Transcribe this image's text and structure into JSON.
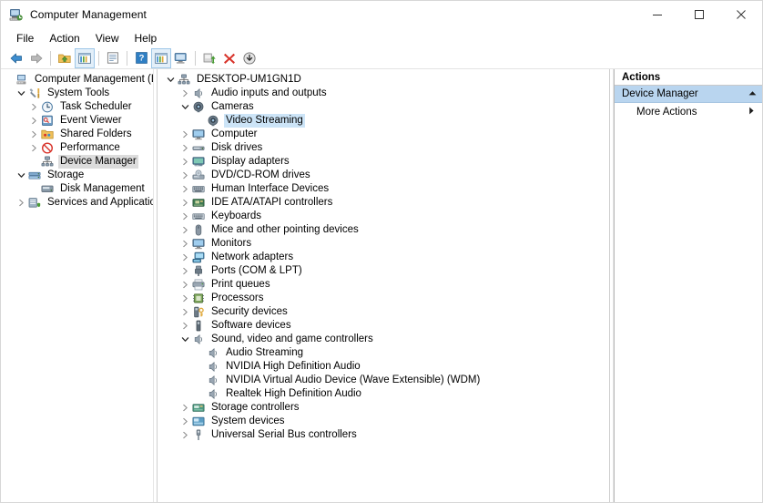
{
  "window": {
    "title": "Computer Management",
    "icon": "computer-management-icon",
    "controls": {
      "minimize": "minimize-icon",
      "maximize": "maximize-icon",
      "close": "close-icon"
    }
  },
  "menubar": {
    "items": [
      {
        "label": "File"
      },
      {
        "label": "Action"
      },
      {
        "label": "View"
      },
      {
        "label": "Help"
      }
    ]
  },
  "toolbar": {
    "buttons": [
      {
        "name": "back-icon"
      },
      {
        "name": "forward-icon"
      },
      {
        "name": "up-folder-icon"
      },
      {
        "name": "show-hide-console-tree-icon"
      },
      {
        "name": "properties-icon"
      },
      {
        "name": "help-icon"
      },
      {
        "name": "show-hide-action-pane-icon"
      },
      {
        "name": "scan-hardware-changes-icon"
      },
      {
        "name": "update-driver-icon"
      },
      {
        "name": "uninstall-device-icon"
      },
      {
        "name": "disable-device-icon"
      }
    ]
  },
  "console_tree": {
    "items": [
      {
        "label": "Computer Management (Local",
        "depth": 0,
        "twisty": "none",
        "icon": "computer-management-icon",
        "selected": "none"
      },
      {
        "label": "System Tools",
        "depth": 1,
        "twisty": "expanded",
        "icon": "system-tools-icon",
        "selected": "none"
      },
      {
        "label": "Task Scheduler",
        "depth": 2,
        "twisty": "collapsed",
        "icon": "clock-icon",
        "selected": "none"
      },
      {
        "label": "Event Viewer",
        "depth": 2,
        "twisty": "collapsed",
        "icon": "event-viewer-icon",
        "selected": "none"
      },
      {
        "label": "Shared Folders",
        "depth": 2,
        "twisty": "collapsed",
        "icon": "shared-folders-icon",
        "selected": "none"
      },
      {
        "label": "Performance",
        "depth": 2,
        "twisty": "collapsed",
        "icon": "performance-icon",
        "selected": "none"
      },
      {
        "label": "Device Manager",
        "depth": 2,
        "twisty": "none",
        "icon": "device-manager-icon",
        "selected": "inactive"
      },
      {
        "label": "Storage",
        "depth": 1,
        "twisty": "expanded",
        "icon": "storage-icon",
        "selected": "none"
      },
      {
        "label": "Disk Management",
        "depth": 2,
        "twisty": "none",
        "icon": "disk-management-icon",
        "selected": "none"
      },
      {
        "label": "Services and Applications",
        "depth": 1,
        "twisty": "collapsed",
        "icon": "services-icon",
        "selected": "none"
      }
    ]
  },
  "device_tree": {
    "items": [
      {
        "label": "DESKTOP-UM1GN1D",
        "depth": 0,
        "twisty": "expanded",
        "icon": "computer-node-icon",
        "selected": "none"
      },
      {
        "label": "Audio inputs and outputs",
        "depth": 1,
        "twisty": "collapsed",
        "icon": "speaker-icon",
        "selected": "none"
      },
      {
        "label": "Cameras",
        "depth": 1,
        "twisty": "expanded",
        "icon": "camera-icon",
        "selected": "none"
      },
      {
        "label": "Video Streaming",
        "depth": 2,
        "twisty": "none",
        "icon": "camera-icon",
        "selected": "active"
      },
      {
        "label": "Computer",
        "depth": 1,
        "twisty": "collapsed",
        "icon": "monitor-icon",
        "selected": "none"
      },
      {
        "label": "Disk drives",
        "depth": 1,
        "twisty": "collapsed",
        "icon": "disk-drive-icon",
        "selected": "none"
      },
      {
        "label": "Display adapters",
        "depth": 1,
        "twisty": "collapsed",
        "icon": "display-adapter-icon",
        "selected": "none"
      },
      {
        "label": "DVD/CD-ROM drives",
        "depth": 1,
        "twisty": "collapsed",
        "icon": "dvd-drive-icon",
        "selected": "none"
      },
      {
        "label": "Human Interface Devices",
        "depth": 1,
        "twisty": "collapsed",
        "icon": "hid-icon",
        "selected": "none"
      },
      {
        "label": "IDE ATA/ATAPI controllers",
        "depth": 1,
        "twisty": "collapsed",
        "icon": "ide-controller-icon",
        "selected": "none"
      },
      {
        "label": "Keyboards",
        "depth": 1,
        "twisty": "collapsed",
        "icon": "keyboard-icon",
        "selected": "none"
      },
      {
        "label": "Mice and other pointing devices",
        "depth": 1,
        "twisty": "collapsed",
        "icon": "mouse-icon",
        "selected": "none"
      },
      {
        "label": "Monitors",
        "depth": 1,
        "twisty": "collapsed",
        "icon": "monitor-icon",
        "selected": "none"
      },
      {
        "label": "Network adapters",
        "depth": 1,
        "twisty": "collapsed",
        "icon": "network-adapter-icon",
        "selected": "none"
      },
      {
        "label": "Ports (COM & LPT)",
        "depth": 1,
        "twisty": "collapsed",
        "icon": "port-icon",
        "selected": "none"
      },
      {
        "label": "Print queues",
        "depth": 1,
        "twisty": "collapsed",
        "icon": "printer-icon",
        "selected": "none"
      },
      {
        "label": "Processors",
        "depth": 1,
        "twisty": "collapsed",
        "icon": "processor-icon",
        "selected": "none"
      },
      {
        "label": "Security devices",
        "depth": 1,
        "twisty": "collapsed",
        "icon": "security-device-icon",
        "selected": "none"
      },
      {
        "label": "Software devices",
        "depth": 1,
        "twisty": "collapsed",
        "icon": "software-device-icon",
        "selected": "none"
      },
      {
        "label": "Sound, video and game controllers",
        "depth": 1,
        "twisty": "expanded",
        "icon": "speaker-icon",
        "selected": "none"
      },
      {
        "label": "Audio Streaming",
        "depth": 2,
        "twisty": "none",
        "icon": "speaker-icon",
        "selected": "none"
      },
      {
        "label": "NVIDIA High Definition Audio",
        "depth": 2,
        "twisty": "none",
        "icon": "speaker-icon",
        "selected": "none"
      },
      {
        "label": "NVIDIA Virtual Audio Device (Wave Extensible) (WDM)",
        "depth": 2,
        "twisty": "none",
        "icon": "speaker-icon",
        "selected": "none"
      },
      {
        "label": "Realtek High Definition Audio",
        "depth": 2,
        "twisty": "none",
        "icon": "speaker-icon",
        "selected": "none"
      },
      {
        "label": "Storage controllers",
        "depth": 1,
        "twisty": "collapsed",
        "icon": "storage-controller-icon",
        "selected": "none"
      },
      {
        "label": "System devices",
        "depth": 1,
        "twisty": "collapsed",
        "icon": "system-device-icon",
        "selected": "none"
      },
      {
        "label": "Universal Serial Bus controllers",
        "depth": 1,
        "twisty": "collapsed",
        "icon": "usb-icon",
        "selected": "none"
      }
    ]
  },
  "actions_pane": {
    "header": "Actions",
    "group_title": "Device Manager",
    "group_collapse_icon": "chevron-up-icon",
    "rows": [
      {
        "label": "More Actions",
        "arrow": "chevron-right-icon"
      }
    ]
  },
  "colors": {
    "selection_active": "#cce4f7",
    "selection_inactive": "#dcdcdc",
    "actions_group_header": "#b9d5ef",
    "toolbar_framed": "#e3eff9"
  }
}
